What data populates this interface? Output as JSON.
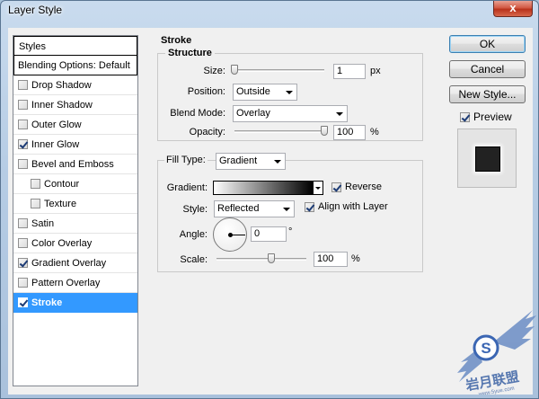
{
  "window": {
    "title": "Layer Style",
    "close_label": "x"
  },
  "styles_panel": {
    "header": "Styles",
    "blending_options": "Blending Options: Default",
    "items": [
      {
        "label": "Drop Shadow",
        "checked": false,
        "sub": false
      },
      {
        "label": "Inner Shadow",
        "checked": false,
        "sub": false
      },
      {
        "label": "Outer Glow",
        "checked": false,
        "sub": false
      },
      {
        "label": "Inner Glow",
        "checked": true,
        "sub": false
      },
      {
        "label": "Bevel and Emboss",
        "checked": false,
        "sub": false
      },
      {
        "label": "Contour",
        "checked": false,
        "sub": true
      },
      {
        "label": "Texture",
        "checked": false,
        "sub": true
      },
      {
        "label": "Satin",
        "checked": false,
        "sub": false
      },
      {
        "label": "Color Overlay",
        "checked": false,
        "sub": false
      },
      {
        "label": "Gradient Overlay",
        "checked": true,
        "sub": false
      },
      {
        "label": "Pattern Overlay",
        "checked": false,
        "sub": false
      },
      {
        "label": "Stroke",
        "checked": true,
        "sub": false,
        "selected": true
      }
    ]
  },
  "stroke": {
    "title": "Stroke",
    "structure": {
      "title": "Structure",
      "size_label": "Size:",
      "size_value": "1",
      "size_unit": "px",
      "position_label": "Position:",
      "position_value": "Outside",
      "blend_label": "Blend Mode:",
      "blend_value": "Overlay",
      "opacity_label": "Opacity:",
      "opacity_value": "100",
      "opacity_unit": "%"
    },
    "fill": {
      "fill_type_label": "Fill Type:",
      "fill_type_value": "Gradient",
      "gradient_label": "Gradient:",
      "reverse_label": "Reverse",
      "reverse_checked": true,
      "style_label": "Style:",
      "style_value": "Reflected",
      "align_label": "Align with Layer",
      "align_checked": true,
      "angle_label": "Angle:",
      "angle_value": "0",
      "angle_unit": "°",
      "scale_label": "Scale:",
      "scale_value": "100",
      "scale_unit": "%"
    }
  },
  "buttons": {
    "ok": "OK",
    "cancel": "Cancel",
    "new_style": "New Style..."
  },
  "preview": {
    "label": "Preview",
    "checked": true
  },
  "watermark": {
    "text": "岩月联盟",
    "url": "www.5yue.com"
  }
}
